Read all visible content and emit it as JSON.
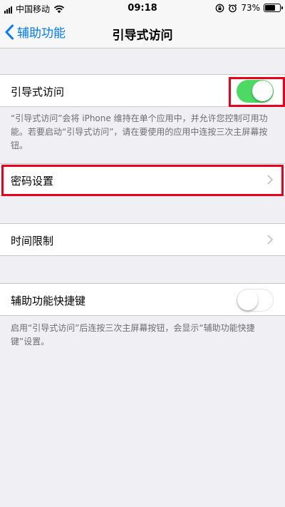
{
  "status_bar": {
    "carrier": "中国移动",
    "time": "09:18",
    "battery": "73%",
    "battery_level": 0.73
  },
  "nav": {
    "back_label": "辅助功能",
    "title": "引导式访问"
  },
  "guided_access": {
    "label": "引导式访问",
    "enabled": true,
    "footer": "“引导式访问”会将 iPhone 维持在单个应用中，并允许您控制可用功能。若要启动“引导式访问”，请在要使用的应用中连按三次主屏幕按钮。"
  },
  "passcode_settings": {
    "label": "密码设置"
  },
  "time_limits": {
    "label": "时间限制"
  },
  "accessibility_shortcut": {
    "label": "辅助功能快捷键",
    "enabled": false,
    "footer": "启用“引导式访问”后连按三次主屏幕按钮，会显示“辅助功能快捷键”设置。"
  },
  "colors": {
    "accent": "#007aff",
    "switch_on": "#4cd964",
    "highlight": "#e8001d",
    "background": "#efeff4"
  }
}
